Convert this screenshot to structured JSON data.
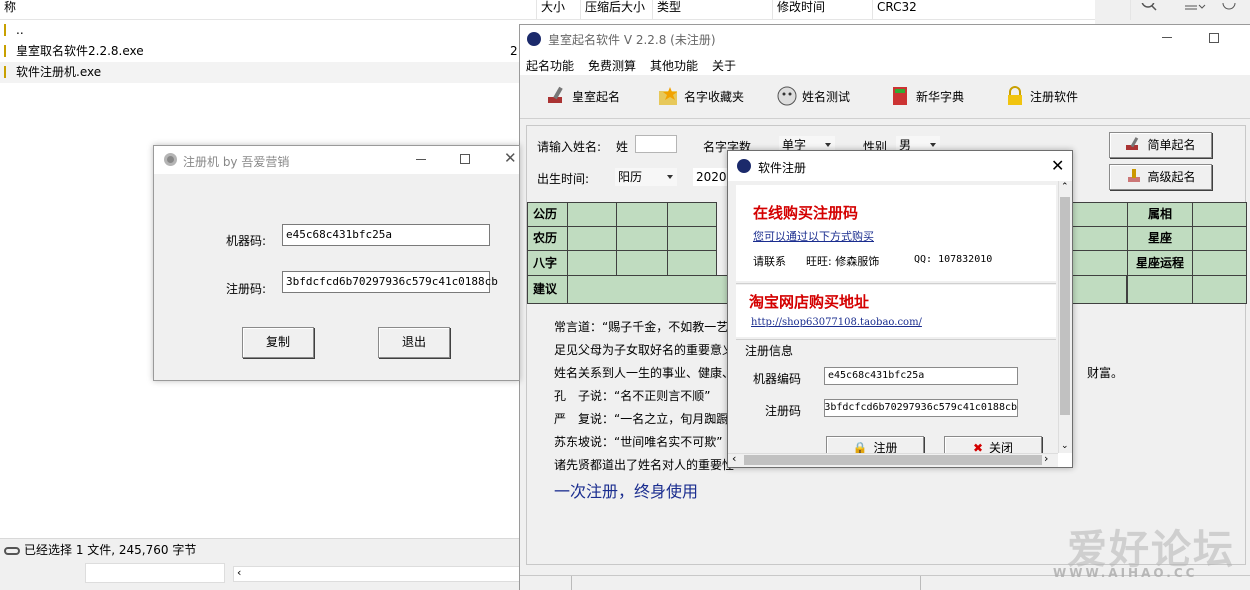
{
  "file_manager": {
    "columns": [
      "称",
      "大小",
      "压缩后大小",
      "类型",
      "修改时间",
      "CRC32"
    ],
    "rows": [
      {
        "name": ".."
      },
      {
        "name": "皇室取名软件2.2.8.exe",
        "size_fragment": "2"
      },
      {
        "name": "软件注册机.exe"
      }
    ],
    "status": "已经选择 1 文件, 245,760 字节"
  },
  "main_window": {
    "title": "皇室起名软件 V 2.2.8 (未注册)",
    "menu": [
      "起名功能",
      "免费测算",
      "其他功能",
      "关于"
    ],
    "toolbar": [
      "皇室起名",
      "名字收藏夹",
      "姓名测试",
      "新华字典",
      "注册软件"
    ],
    "form": {
      "name_prompt": "请输入姓名:",
      "surname_label": "姓",
      "name_chars_label": "名字字数",
      "name_chars_value": "单字",
      "gender_label": "性别",
      "gender_value": "男",
      "birth_label": "出生时间:",
      "calendar_value": "阳历",
      "year_value": "2020",
      "simple_button": "简单起名",
      "advanced_button": "高级起名"
    },
    "grid_left": [
      "公历",
      "农历",
      "八字",
      "建议"
    ],
    "grid_right": [
      "属相",
      "星座",
      "星座运程"
    ],
    "paragraphs": [
      "常言道：“赐子千金，不如教一艺",
      "足见父母为子女取好名的重要意义",
      "姓名关系到人一生的事业、健康、",
      "孔　子说：“名不正则言不顺”",
      "严　复说：“一名之立，旬月踟蹰",
      "苏东坡说：“世间唯名实不可欺”",
      "诸先贤都道出了姓名对人的重要性"
    ],
    "paragraph_tail": "财富。",
    "slogan": "一次注册，终身使用"
  },
  "keygen": {
    "title": "注册机  by 吾爱营销",
    "machine_label": "机器码:",
    "machine_value": "e45c68c431bfc25a",
    "reg_label": "注册码:",
    "reg_value": "3bfdcfcd6b70297936c579c41c0188cb",
    "copy_button": "复制",
    "exit_button": "退出"
  },
  "register_dialog": {
    "title": "软件注册",
    "buy_heading": "在线购买注册码",
    "buy_link": "您可以通过以下方式购买",
    "contact_label": "请联系",
    "contact_value": "旺旺: 修森服饰",
    "qq": "QQ: 107832010",
    "shop_heading": "淘宝网店购买地址",
    "shop_url": "http://shop63077108.taobao.com/",
    "info_label": "注册信息",
    "machine_label": "机器编码",
    "machine_value": "e45c68c431bfc25a",
    "reg_label": "注册码",
    "reg_value": "3bfdcfcd6b70297936c579c41c0188cb",
    "register_button": "注册",
    "close_button": "关闭"
  },
  "watermark": {
    "big": "爱好论坛",
    "small": "WWW.AIHAO.CC"
  }
}
